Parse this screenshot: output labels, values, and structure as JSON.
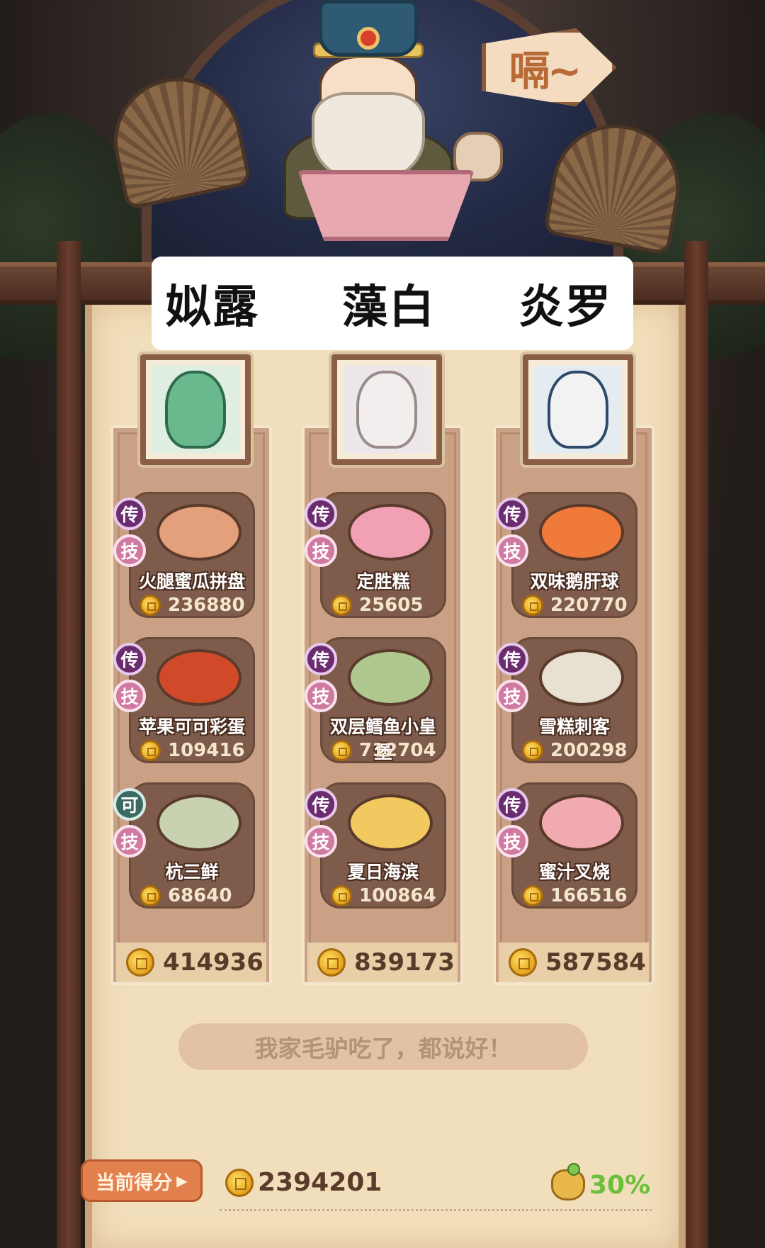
{
  "header": {
    "speech_bubble": "嗝~"
  },
  "names": [
    "姒露",
    "藻白",
    "炎罗"
  ],
  "columns": [
    {
      "character": "green-haired-scholar",
      "dishes": [
        {
          "badge_top": "传",
          "badge_bottom": "技",
          "name": "火腿蜜瓜拼盘",
          "score": "236880",
          "food_color": "#e4a07a"
        },
        {
          "badge_top": "传",
          "badge_bottom": "技",
          "name": "苹果可可彩蛋",
          "score": "109416",
          "food_color": "#d04a2a"
        },
        {
          "badge_top": "可",
          "badge_bottom": "技",
          "name": "杭三鲜",
          "score": "68640",
          "food_color": "#c8d2b0"
        }
      ],
      "total": "414936"
    },
    {
      "character": "chef-bun",
      "dishes": [
        {
          "badge_top": "传",
          "badge_bottom": "技",
          "name": "定胜糕",
          "score": "25605",
          "food_color": "#f2a0b4"
        },
        {
          "badge_top": "传",
          "badge_bottom": "技",
          "name": "双层鳕鱼小皇堡",
          "score": "712704",
          "food_color": "#b0c890"
        },
        {
          "badge_top": "传",
          "badge_bottom": "技",
          "name": "夏日海滨",
          "score": "100864",
          "food_color": "#f2c860"
        }
      ],
      "total": "839173"
    },
    {
      "character": "panda-official",
      "dishes": [
        {
          "badge_top": "传",
          "badge_bottom": "技",
          "name": "双味鹅肝球",
          "score": "220770",
          "food_color": "#f07a3a"
        },
        {
          "badge_top": "传",
          "badge_bottom": "技",
          "name": "雪糕刺客",
          "score": "200298",
          "food_color": "#e8e0d0"
        },
        {
          "badge_top": "传",
          "badge_bottom": "技",
          "name": "蜜汁叉烧",
          "score": "166516",
          "food_color": "#f0aab0"
        }
      ],
      "total": "587584"
    }
  ],
  "quote": "我家毛驴吃了，都说好！",
  "footer": {
    "score_label": "当前得分",
    "arrow": "▶",
    "current_score": "2394201",
    "bonus": "30%"
  },
  "colors": {
    "purple_badge": "#6a2c6e",
    "pink_badge": "#d07aa2",
    "green_badge": "#3a6a62",
    "bonus_green": "#6bbf3a"
  },
  "icons": {
    "coin": "gold-coin-icon",
    "bonus": "money-bag-icon"
  }
}
